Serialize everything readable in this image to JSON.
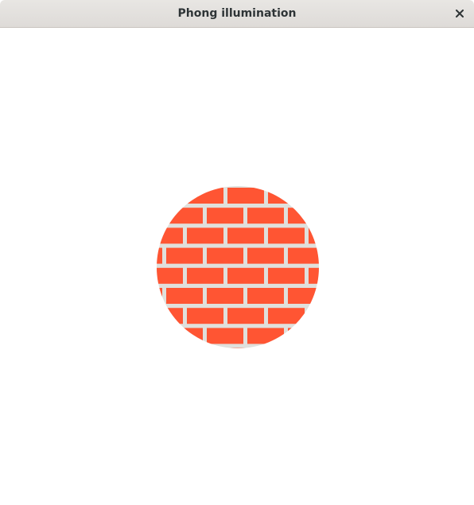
{
  "window": {
    "title": "Phong illumination",
    "close_glyph": "close-icon"
  },
  "scene": {
    "object": "sphere",
    "texture": "brick",
    "brick_color": "#ff5533",
    "mortar_color": "#e0e0dc",
    "background_color": "#ffffff"
  }
}
